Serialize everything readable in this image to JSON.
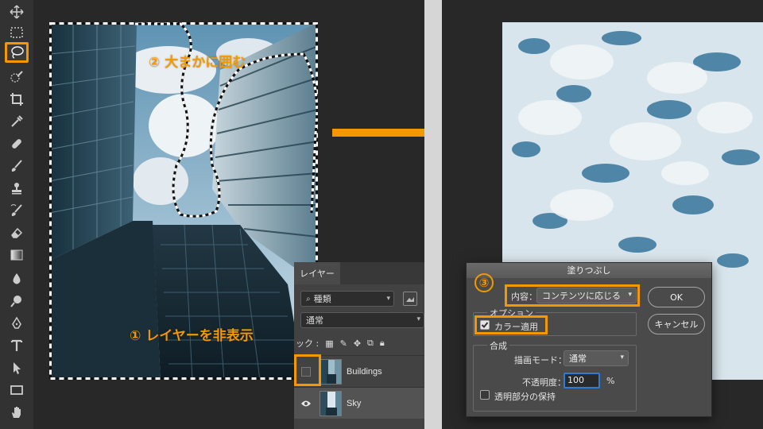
{
  "annotations": {
    "step1": "① レイヤーを非表示",
    "step2": "② 大まかに囲む",
    "step3": "③"
  },
  "toolbar": {
    "tools": [
      "move-icon",
      "marquee-icon",
      "lasso-icon",
      "quick-select-icon",
      "crop-icon",
      "eyedropper-icon",
      "healing-icon",
      "brush-icon",
      "stamp-icon",
      "history-brush-icon",
      "eraser-icon",
      "gradient-icon",
      "blur-icon",
      "dodge-icon",
      "pen-icon",
      "type-icon",
      "path-select-icon",
      "rectangle-icon",
      "hand-icon"
    ],
    "active_tool": "lasso-icon"
  },
  "layers_panel": {
    "tab": "レイヤー",
    "filter_label": "種類",
    "blend_mode": "通常",
    "lock_label": "ック :",
    "layers": [
      {
        "name": "Buildings",
        "visible": false
      },
      {
        "name": "Sky",
        "visible": true
      }
    ]
  },
  "fill_dialog": {
    "title": "塗りつぶし",
    "contents_label": "内容：",
    "contents_value": "コンテンツに応じる",
    "options_legend": "オプション",
    "color_adapt_label": "カラー適用",
    "color_adapt_checked": true,
    "blending_legend": "合成",
    "mode_label": "描画モード：",
    "mode_value": "通常",
    "opacity_label": "不透明度：",
    "opacity_value": "100",
    "opacity_unit": "%",
    "preserve_label": "透明部分の保持",
    "preserve_checked": false,
    "ok": "OK",
    "cancel": "キャンセル"
  },
  "colors": {
    "accent": "#f39800",
    "panel": "#424242",
    "dialog": "#4a4a4a",
    "background": "#282828"
  }
}
